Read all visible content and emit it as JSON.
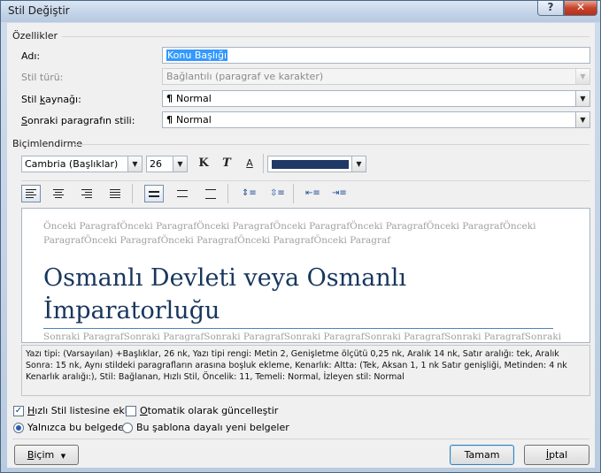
{
  "window": {
    "title": "Stil Değiştir",
    "help_label": "?",
    "close_label": "✕"
  },
  "properties": {
    "group_label": "Özellikler",
    "name_label": "Adı:",
    "name_value": "Konu Başlığı",
    "style_type_label": "Stil türü:",
    "style_type_value": "Bağlantılı (paragraf ve karakter)",
    "style_based_label_pre": "Stil ",
    "style_based_label_ul": "k",
    "style_based_label_post": "aynağı:",
    "style_based_value": "Normal",
    "next_style_label_ul": "S",
    "next_style_label_post": "onraki paragrafın stili:",
    "next_style_value": "Normal",
    "paragraph_mark": "¶"
  },
  "formatting": {
    "group_label": "Biçimlendirme",
    "font_name": "Cambria (Başlıklar)",
    "font_size": "26",
    "bold_glyph": "K",
    "italic_glyph": "T",
    "underline_glyph": "A",
    "font_color": "#1f3864",
    "alignment_selected": "left",
    "line_spacing_selected": "single"
  },
  "preview": {
    "previous_text": "Önceki ParagrafÖnceki ParagrafÖnceki ParagrafÖnceki ParagrafÖnceki ParagrafÖnceki ParagrafÖnceki ParagrafÖnceki ParagrafÖnceki ParagrafÖnceki ParagrafÖnceki Paragraf",
    "heading_text": "Osmanlı Devleti veya Osmanlı İmparatorluğu",
    "next_text": "Sonraki ParagrafSonraki ParagrafSonraki ParagrafSonraki ParagrafSonraki ParagrafSonraki ParagrafSonraki ParagrafSonraki Paragraf"
  },
  "description": "Yazı tipi: (Varsayılan) +Başlıklar, 26 nk, Yazı tipi rengi: Metin 2, Genişletme ölçütü  0,25 nk, Aralık 14 nk, Satır aralığı:  tek, Aralık Sonra:  15 nk, Aynı stildeki paragrafların arasına boşluk ekleme, Kenarlık: Altta: (Tek, Aksan 1,  1 nk Satır genişliği, Metinden:  4 nk Kenarlık aralığı:), Stil: Bağlanan, Hızlı Stil, Öncelik: 11, Temeli: Normal, İzleyen stil: Normal",
  "options": {
    "quick_style_label_ul": "H",
    "quick_style_label_post": "ızlı Stil listesine ekle",
    "quick_style_checked": true,
    "auto_update_label_ul": "O",
    "auto_update_label_post": "tomatik olarak güncelleştir",
    "auto_update_checked": false,
    "only_this_doc_label": "Yalnızca bu belgede",
    "template_label": "Bu şablona dayalı yeni belgeler",
    "selected_scope": "only_this_doc"
  },
  "buttons": {
    "format_label_ul": "B",
    "format_label_post": "içim",
    "format_arrow": "▼",
    "ok_label": "Tamam",
    "cancel_label": "İptal",
    "cancel_ul": "İ",
    "cancel_post": "ptal"
  }
}
